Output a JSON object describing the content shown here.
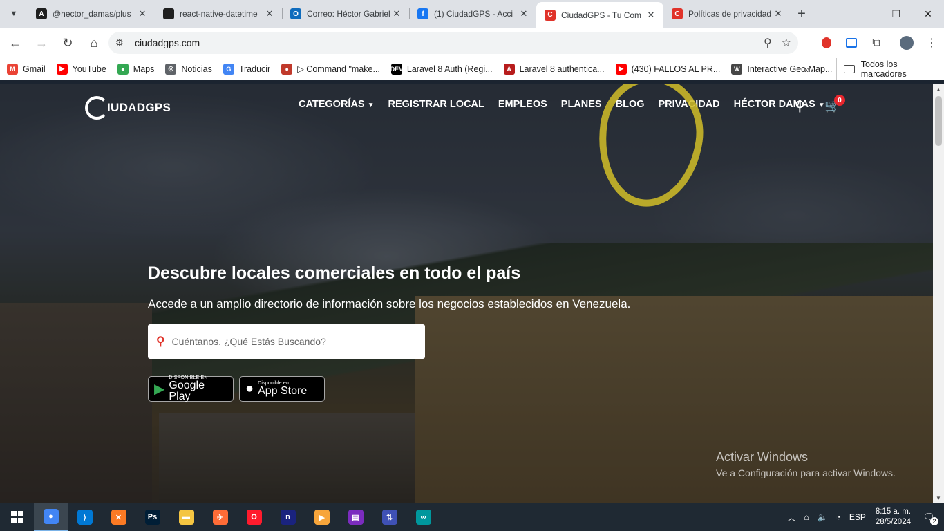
{
  "tabs": [
    {
      "title": "@hector_damas/plus",
      "icon": "A",
      "color": "#1f1f1f"
    },
    {
      "title": "react-native-datetime",
      "icon": "github-icon",
      "color": "#1f1f1f"
    },
    {
      "title": "Correo: Héctor Gabriel",
      "icon": "O",
      "color": "#0f6cbd"
    },
    {
      "title": "(1) CiudadGPS - Acci",
      "icon": "f",
      "color": "#1877f2"
    },
    {
      "title": "CiudadGPS - Tu Com",
      "icon": "C",
      "color": "#e0332a"
    },
    {
      "title": "Políticas de privacidad",
      "icon": "C",
      "color": "#e0332a"
    }
  ],
  "address": "ciudadgps.com",
  "bookmarks": [
    {
      "label": "Gmail",
      "icon": "M",
      "color": "#ea4335"
    },
    {
      "label": "YouTube",
      "icon": "▶",
      "color": "#ff0000"
    },
    {
      "label": "Maps",
      "icon": "●",
      "color": "#34a853"
    },
    {
      "label": "Noticias",
      "icon": "◎",
      "color": "#5f6368"
    },
    {
      "label": "Traducir",
      "icon": "G",
      "color": "#4285f4"
    },
    {
      "label": "▷ Command \"make...",
      "icon": "●",
      "color": "#c0392b"
    },
    {
      "label": "Laravel 8 Auth (Regi...",
      "icon": "DEV",
      "color": "#000000"
    },
    {
      "label": "Laravel 8 authentica...",
      "icon": "A",
      "color": "#b71c1c"
    },
    {
      "label": "(430) FALLOS AL PR...",
      "icon": "▶",
      "color": "#ff0000"
    },
    {
      "label": "Interactive Geo Map...",
      "icon": "W",
      "color": "#464646"
    }
  ],
  "bookmarks_all": "Todos los marcadores",
  "site": {
    "logo": "IUDADGPS",
    "menu": [
      {
        "label": "CATEGORÍAS",
        "dropdown": true
      },
      {
        "label": "REGISTRAR LOCAL",
        "dropdown": false
      },
      {
        "label": "EMPLEOS",
        "dropdown": false
      },
      {
        "label": "PLANES",
        "dropdown": false
      },
      {
        "label": "BLOG",
        "dropdown": false
      },
      {
        "label": "PRIVACIDAD",
        "dropdown": false
      },
      {
        "label": "HÉCTOR DAMAS",
        "dropdown": true
      }
    ],
    "cart_count": "0",
    "hero_title": "Descubre locales comerciales en todo el país",
    "hero_subtitle": "Accede a un amplio directorio de información sobre los negocios establecidos en Venezuela.",
    "search_placeholder": "Cuéntanos. ¿Qué Estás Buscando?",
    "google_small": "DISPONIBLE EN",
    "google_big": "Google Play",
    "apple_small": "Disponible en",
    "apple_big": "App Store"
  },
  "watermark": {
    "line1": "Activar Windows",
    "line2": "Ve a Configuración para activar Windows."
  },
  "taskbar": {
    "apps": [
      {
        "name": "chrome",
        "glyph": "●",
        "color": "#4285f4",
        "active": true
      },
      {
        "name": "vscode",
        "glyph": "⟩",
        "color": "#0078d4",
        "active": false
      },
      {
        "name": "xampp",
        "glyph": "✕",
        "color": "#fb7a24",
        "active": false
      },
      {
        "name": "photoshop",
        "glyph": "Ps",
        "color": "#001e36",
        "active": false
      },
      {
        "name": "explorer",
        "glyph": "▬",
        "color": "#f4c542",
        "active": false
      },
      {
        "name": "postman",
        "glyph": "✈",
        "color": "#ff6c37",
        "active": false
      },
      {
        "name": "opera",
        "glyph": "O",
        "color": "#ff1b2d",
        "active": false
      },
      {
        "name": "app-n",
        "glyph": "n",
        "color": "#1a237e",
        "active": false
      },
      {
        "name": "media-player",
        "glyph": "▶",
        "color": "#f7a53b",
        "active": false
      },
      {
        "name": "clapper",
        "glyph": "▤",
        "color": "#7b2cbf",
        "active": false
      },
      {
        "name": "network-app",
        "glyph": "⇅",
        "color": "#3f51b5",
        "active": false
      },
      {
        "name": "arduino",
        "glyph": "∞",
        "color": "#00979d",
        "active": false
      }
    ],
    "lang": "ESP",
    "time": "8:15 a. m.",
    "date": "28/5/2024",
    "notifications": "2"
  }
}
